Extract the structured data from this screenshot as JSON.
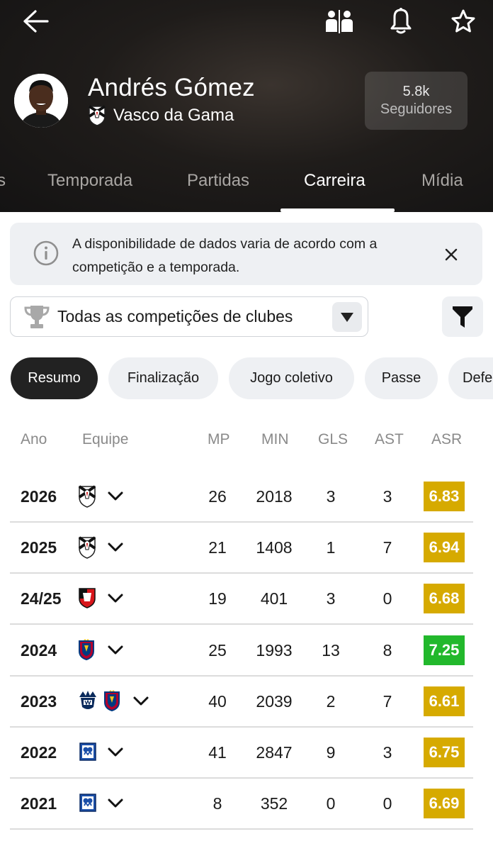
{
  "header": {
    "player_name": "Andrés Gómez",
    "club_name": "Vasco da Gama",
    "followers_count": "5.8k",
    "followers_label": "Seguidores",
    "icons": [
      "back-arrow-icon",
      "compare-players-icon",
      "bell-icon",
      "star-icon"
    ]
  },
  "tabs": [
    {
      "label": "Temporada"
    },
    {
      "label": "Partidas"
    },
    {
      "label": "Carreira",
      "active": true
    },
    {
      "label": "Mídia"
    }
  ],
  "info_banner": {
    "text": "A disponibilidade de dados varia de acordo com a competição e a temporada."
  },
  "competition_filter": {
    "selected": "Todas as competições de clubes"
  },
  "chips": [
    {
      "label": "Resumo",
      "active": true
    },
    {
      "label": "Finalização"
    },
    {
      "label": "Jogo coletivo"
    },
    {
      "label": "Passe"
    },
    {
      "label": "Defe"
    }
  ],
  "table": {
    "headers": {
      "year": "Ano",
      "team": "Equipe",
      "mp": "MP",
      "min": "MIN",
      "gls": "GLS",
      "ast": "AST",
      "asr": "ASR"
    },
    "rows": [
      {
        "year": "2026",
        "teams": [
          "vasco"
        ],
        "mp": "26",
        "min": "2018",
        "gls": "3",
        "ast": "3",
        "asr": "6.83",
        "asr_color": "#d6aa00"
      },
      {
        "year": "2025",
        "teams": [
          "vasco"
        ],
        "mp": "21",
        "min": "1408",
        "gls": "1",
        "ast": "7",
        "asr": "6.94",
        "asr_color": "#d6aa00"
      },
      {
        "year": "24/25",
        "teams": [
          "rennes"
        ],
        "mp": "19",
        "min": "401",
        "gls": "3",
        "ast": "0",
        "asr": "6.68",
        "asr_color": "#d6aa00"
      },
      {
        "year": "2024",
        "teams": [
          "real-salt-lake"
        ],
        "mp": "25",
        "min": "1993",
        "gls": "13",
        "ast": "8",
        "asr": "7.25",
        "asr_color": "#22b82c"
      },
      {
        "year": "2023",
        "teams": [
          "monterrey",
          "real-salt-lake"
        ],
        "mp": "40",
        "min": "2039",
        "gls": "2",
        "ast": "7",
        "asr": "6.61",
        "asr_color": "#d6aa00"
      },
      {
        "year": "2022",
        "teams": [
          "millonarios"
        ],
        "mp": "41",
        "min": "2847",
        "gls": "9",
        "ast": "3",
        "asr": "6.75",
        "asr_color": "#d6aa00"
      },
      {
        "year": "2021",
        "teams": [
          "millonarios"
        ],
        "mp": "8",
        "min": "352",
        "gls": "0",
        "ast": "0",
        "asr": "6.69",
        "asr_color": "#d6aa00"
      }
    ]
  }
}
